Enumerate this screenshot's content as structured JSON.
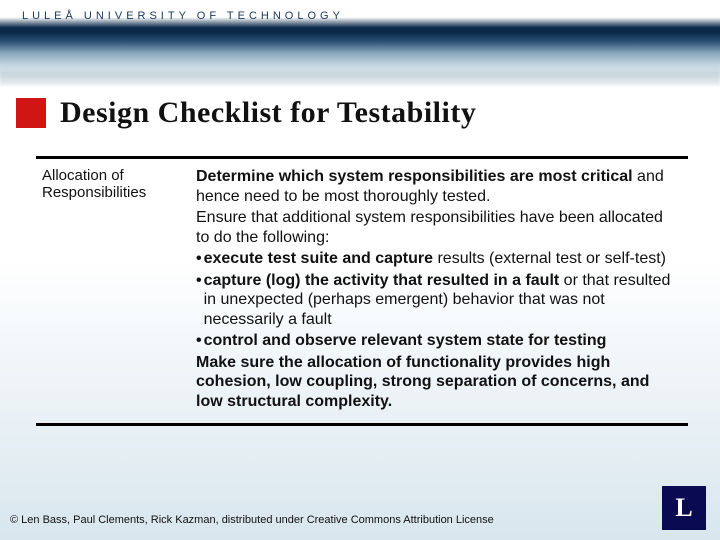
{
  "banner": {
    "university": "LULEÅ  UNIVERSITY  OF  TECHNOLOGY"
  },
  "title": "Design Checklist for Testability",
  "table": {
    "leftHeader": "Allocation of Responsibilities",
    "right": {
      "p1_bold": "Determine which system responsibilities are most critical",
      "p1_rest": " and hence need to be most thoroughly tested.",
      "p2": "Ensure that additional system responsibilities have been allocated to do the following:",
      "b1_bold": "execute test suite and capture",
      "b1_rest": " results (external test or self-test)",
      "b2_bold": "capture (log) the activity that resulted in a fault",
      "b2_rest": " or that resulted in unexpected (perhaps emergent) behavior that was not necessarily a fault",
      "b3_bold": "control and observe relevant system state for testing",
      "p3_bold": "Make sure the allocation of functionality provides high cohesion, low coupling, strong separation of concerns, and low structural complexity."
    }
  },
  "footer": "© Len Bass, Paul Clements, Rick Kazman, distributed under Creative Commons Attribution License",
  "logo": "L"
}
